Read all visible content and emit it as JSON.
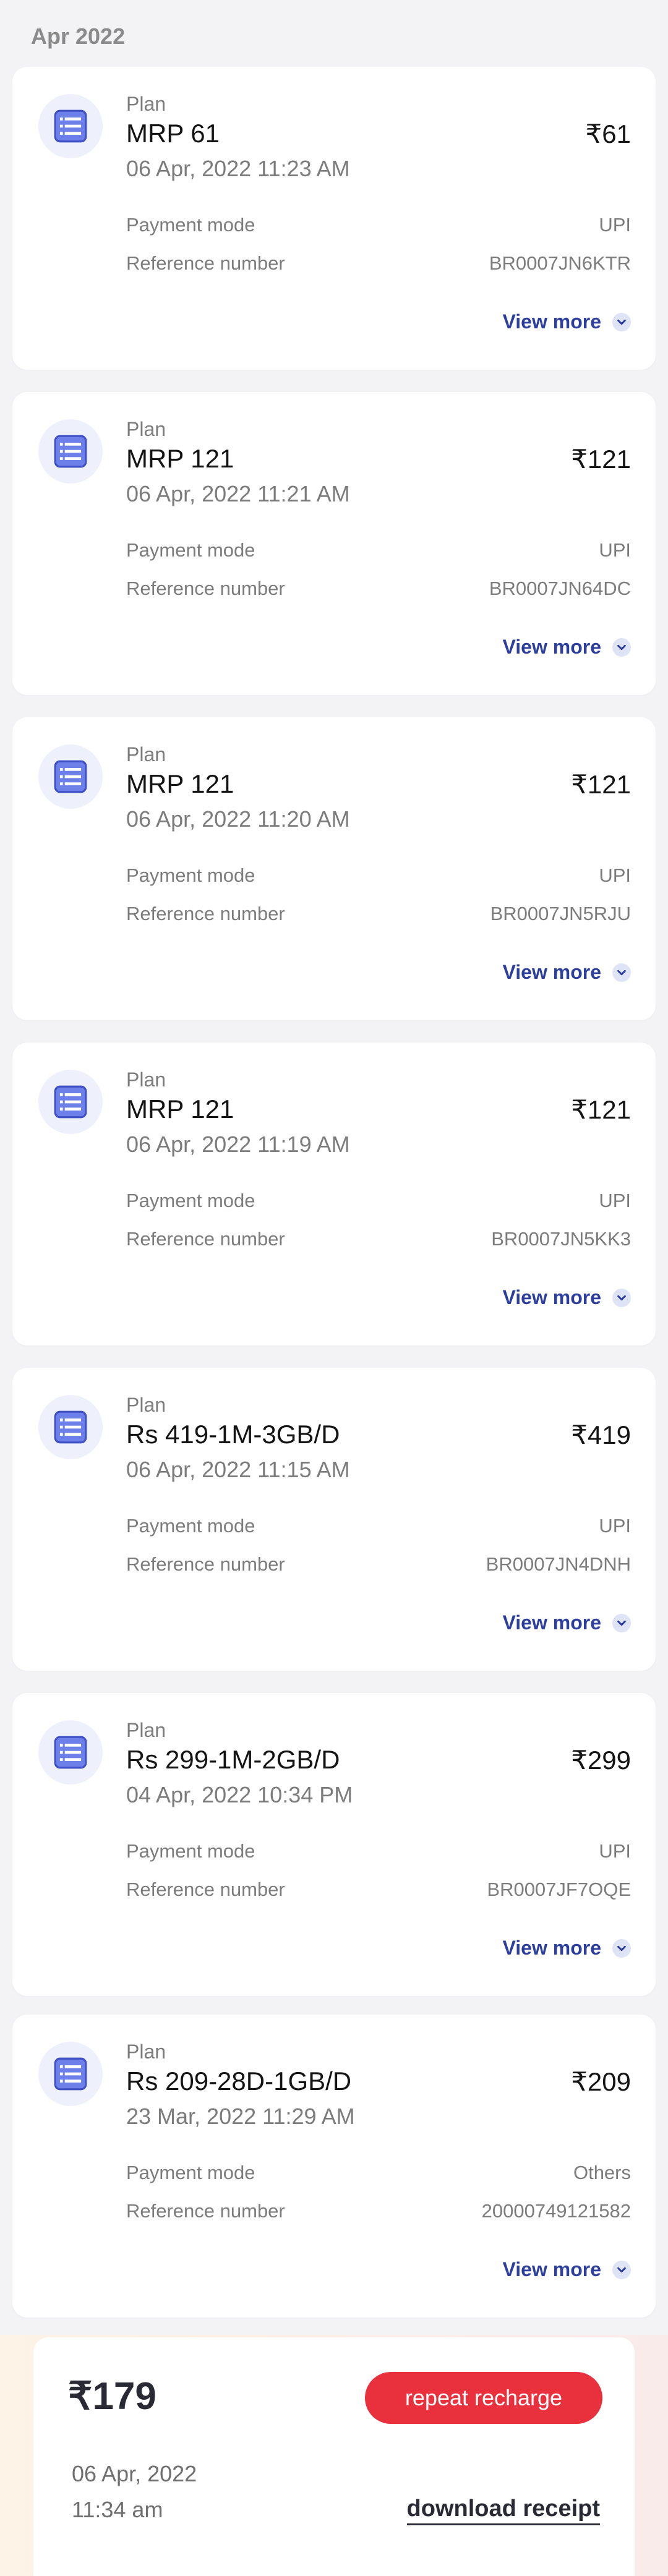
{
  "month_label": "Apr 2022",
  "accent_color": "#2c3e9e",
  "icons": {
    "plan": "plan-list-icon",
    "expand": "chevron-down-icon"
  },
  "transactions": [
    {
      "plan_label": "Plan",
      "name": "MRP 61",
      "price": "₹61",
      "date": "06 Apr, 2022 11:23 AM",
      "payment_mode_label": "Payment mode",
      "payment_mode": "UPI",
      "reference_label": "Reference number",
      "reference": "BR0007JN6KTR",
      "view_more": "View more"
    },
    {
      "plan_label": "Plan",
      "name": "MRP 121",
      "price": "₹121",
      "date": "06 Apr, 2022 11:21 AM",
      "payment_mode_label": "Payment mode",
      "payment_mode": "UPI",
      "reference_label": "Reference number",
      "reference": "BR0007JN64DC",
      "view_more": "View more"
    },
    {
      "plan_label": "Plan",
      "name": "MRP 121",
      "price": "₹121",
      "date": "06 Apr, 2022 11:20 AM",
      "payment_mode_label": "Payment mode",
      "payment_mode": "UPI",
      "reference_label": "Reference number",
      "reference": "BR0007JN5RJU",
      "view_more": "View more"
    },
    {
      "plan_label": "Plan",
      "name": "MRP 121",
      "price": "₹121",
      "date": "06 Apr, 2022 11:19 AM",
      "payment_mode_label": "Payment mode",
      "payment_mode": "UPI",
      "reference_label": "Reference number",
      "reference": "BR0007JN5KK3",
      "view_more": "View more"
    },
    {
      "plan_label": "Plan",
      "name": "Rs 419-1M-3GB/D",
      "price": "₹419",
      "date": "06 Apr, 2022 11:15 AM",
      "payment_mode_label": "Payment mode",
      "payment_mode": "UPI",
      "reference_label": "Reference number",
      "reference": "BR0007JN4DNH",
      "view_more": "View more"
    },
    {
      "plan_label": "Plan",
      "name": "Rs 299-1M-2GB/D",
      "price": "₹299",
      "date": "04 Apr, 2022 10:34 PM",
      "payment_mode_label": "Payment mode",
      "payment_mode": "UPI",
      "reference_label": "Reference number",
      "reference": "BR0007JF7OQE",
      "view_more": "View more"
    },
    {
      "plan_label": "Plan",
      "name": "Rs 209-28D-1GB/D",
      "price": "₹209",
      "date": "23 Mar, 2022 11:29 AM",
      "payment_mode_label": "Payment mode",
      "payment_mode": "Others",
      "reference_label": "Reference number",
      "reference": "20000749121582",
      "view_more": "View more"
    }
  ],
  "footer": {
    "amount": "₹179",
    "repeat_button": "repeat recharge",
    "date": "06 Apr, 2022",
    "time": "11:34 am",
    "download_link": "download receipt",
    "button_color": "#e9303d"
  }
}
